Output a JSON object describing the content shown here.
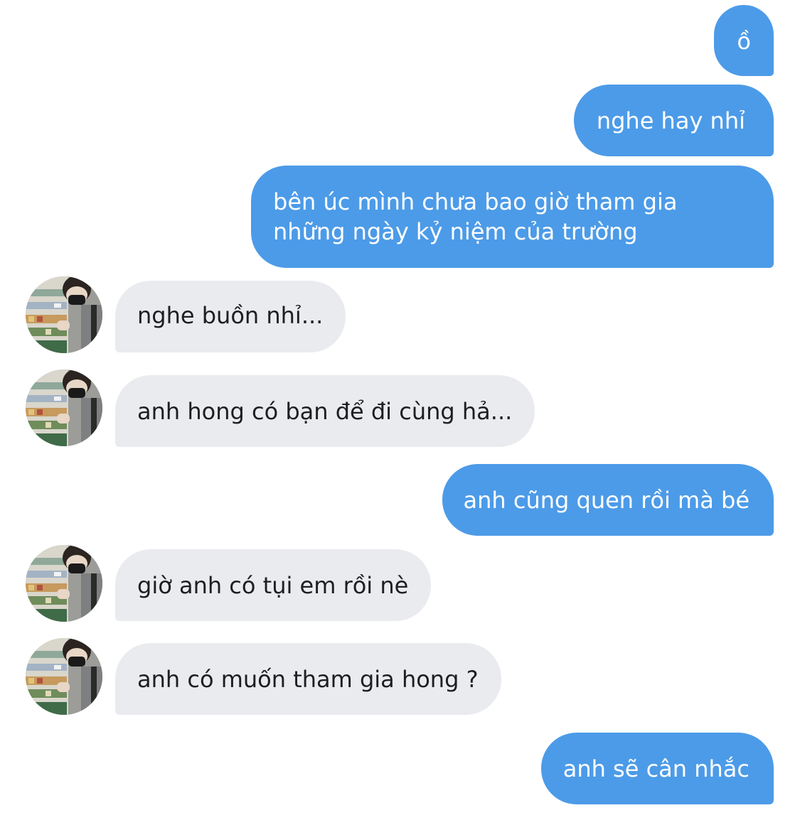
{
  "messages": [
    {
      "direction": "sent",
      "text": "ồ"
    },
    {
      "direction": "sent",
      "text": "nghe hay nhỉ"
    },
    {
      "direction": "sent",
      "lines": [
        "bên úc mình chưa bao giờ tham gia",
        "những ngày kỷ niệm của trường"
      ]
    },
    {
      "direction": "received",
      "text": "nghe buồn nhỉ..."
    },
    {
      "direction": "received",
      "text": "anh hong có bạn để đi cùng hả..."
    },
    {
      "direction": "sent",
      "text": "anh cũng quen rồi mà bé"
    },
    {
      "direction": "received",
      "text": "giờ anh có tụi em rồi nè"
    },
    {
      "direction": "received",
      "text": "anh có muốn tham gia hong ?"
    },
    {
      "direction": "sent",
      "text": "anh sẽ cân nhắc"
    }
  ],
  "colors": {
    "sent_bubble": "#4c9be8",
    "sent_text": "#ffffff",
    "received_bubble": "#e9ebef",
    "received_text": "#1c1e21",
    "background": "#ffffff"
  },
  "icons": {
    "avatar": "contact-profile-photo"
  }
}
